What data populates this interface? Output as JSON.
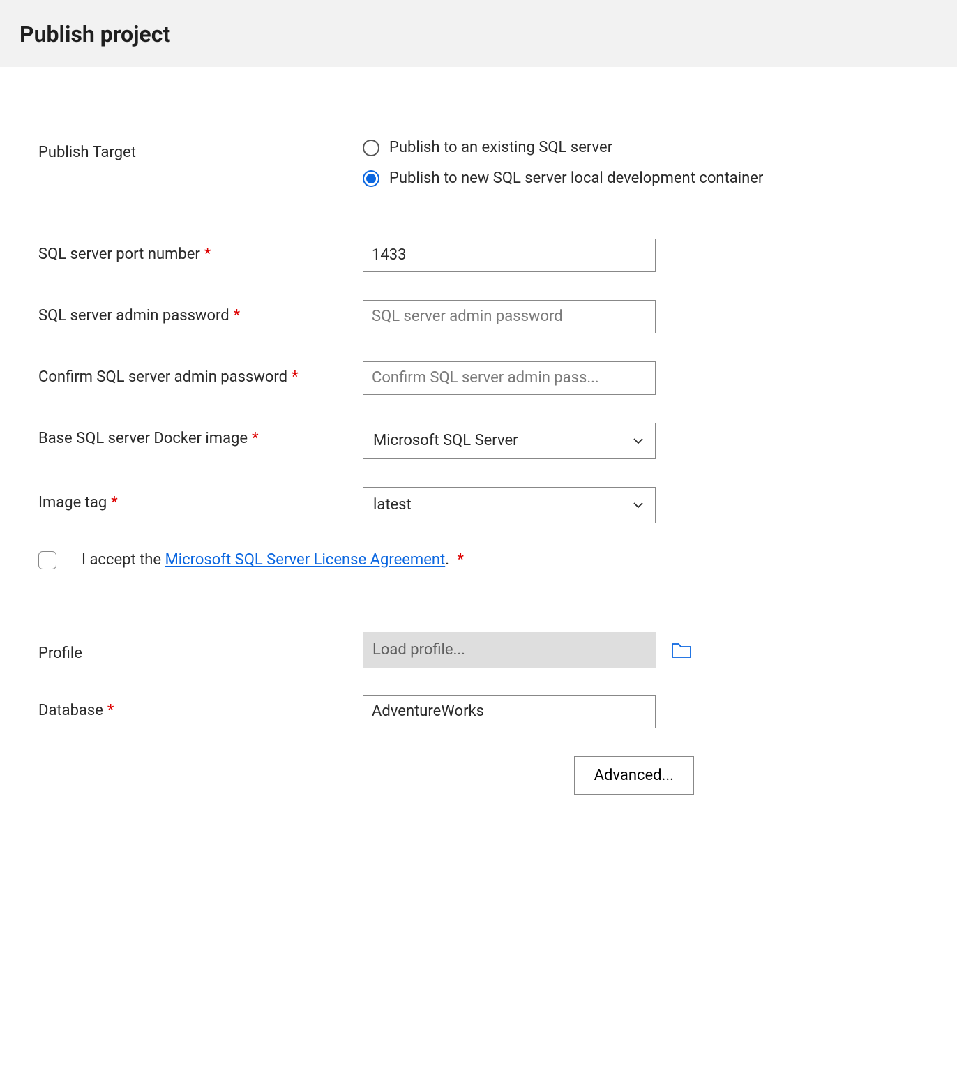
{
  "header": {
    "title": "Publish project"
  },
  "form": {
    "publishTarget": {
      "label": "Publish Target",
      "option1": "Publish to an existing SQL server",
      "option2": "Publish to new SQL server local development container",
      "selected": 1
    },
    "port": {
      "label": "SQL server port number",
      "value": "1433"
    },
    "adminPassword": {
      "label": "SQL server admin password",
      "placeholder": "SQL server admin password"
    },
    "confirmPassword": {
      "label": "Confirm SQL server admin password",
      "placeholder": "Confirm SQL server admin pass..."
    },
    "dockerImage": {
      "label": "Base SQL server Docker image",
      "value": "Microsoft SQL Server"
    },
    "imageTag": {
      "label": "Image tag",
      "value": "latest"
    },
    "license": {
      "prefix": "I accept the ",
      "linkText": "Microsoft SQL Server License Agreement",
      "suffix": "."
    },
    "profile": {
      "label": "Profile",
      "placeholder": "Load profile..."
    },
    "database": {
      "label": "Database",
      "value": "AdventureWorks"
    },
    "advanced": {
      "label": "Advanced..."
    }
  }
}
